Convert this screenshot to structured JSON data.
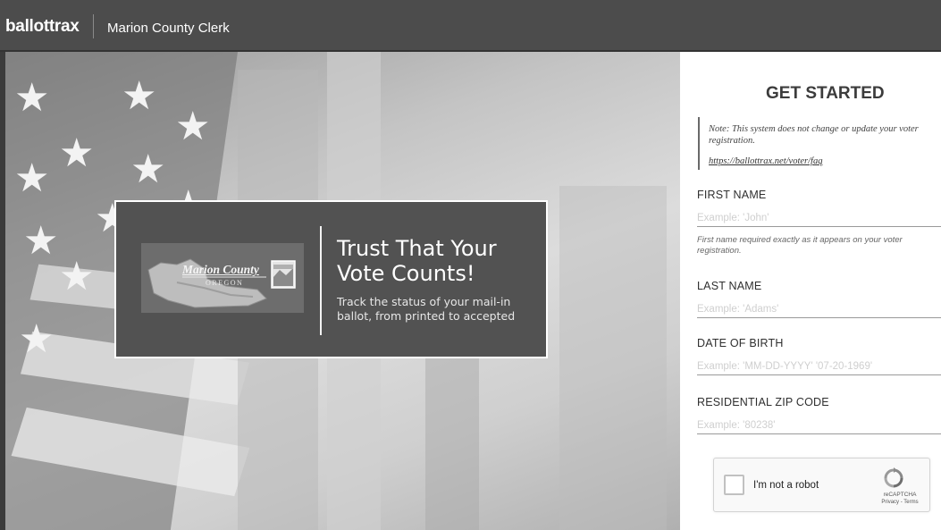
{
  "header": {
    "brand": "ballottrax",
    "title": "Marion County Clerk"
  },
  "hero": {
    "logo_name": "Marion County",
    "logo_state": "OREGON",
    "headline": "Trust That Your Vote Counts!",
    "subtext": "Track the status of your mail-in ballot, from printed to accepted"
  },
  "form": {
    "title": "GET STARTED",
    "note": "Note: This system does not change or update your voter registration.",
    "faq_link": "https://ballottrax.net/voter/faq",
    "first_name": {
      "label": "FIRST NAME",
      "placeholder": "Example: 'John'",
      "value": "",
      "help": "First name required exactly as it appears on your voter registration."
    },
    "last_name": {
      "label": "LAST NAME",
      "placeholder": "Example: 'Adams'",
      "value": ""
    },
    "dob": {
      "label": "DATE OF BIRTH",
      "placeholder": "Example: 'MM-DD-YYYY' '07-20-1969'",
      "value": ""
    },
    "zip": {
      "label": "RESIDENTIAL ZIP CODE",
      "placeholder": "Example: '80238'",
      "value": ""
    },
    "captcha": {
      "label": "I'm not a robot",
      "brand": "reCAPTCHA",
      "links": "Privacy - Terms",
      "icon": "recaptcha-icon"
    }
  },
  "colors": {
    "header_bg": "#4c4c4c",
    "card_bg": "#525252",
    "panel_bg": "#ffffff"
  }
}
